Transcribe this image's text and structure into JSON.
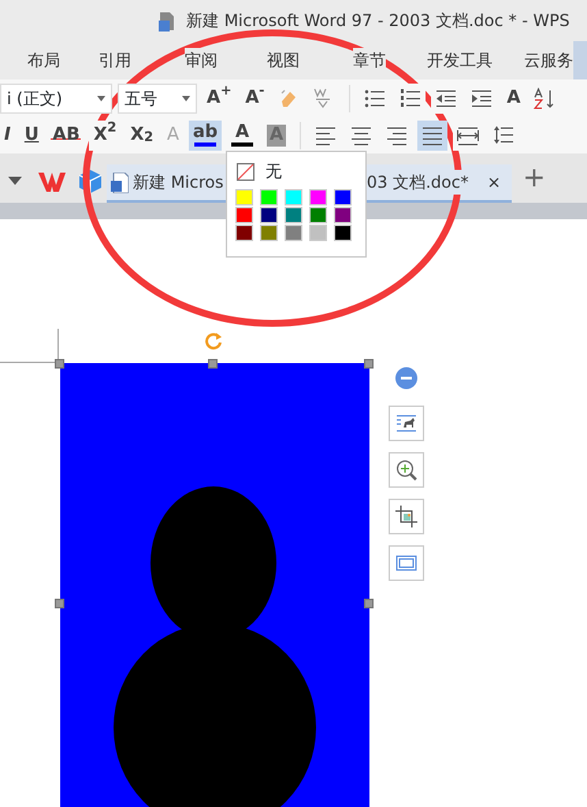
{
  "window": {
    "title": "新建 Microsoft Word 97 - 2003 文档.doc * - WPS"
  },
  "menu": [
    {
      "label": "布局"
    },
    {
      "label": "引用"
    },
    {
      "label": "审阅"
    },
    {
      "label": "视图"
    },
    {
      "label": "章节"
    },
    {
      "label": "开发工具"
    },
    {
      "label": "云服务"
    }
  ],
  "toolbar": {
    "font": "i (正文)",
    "size": "五号",
    "row1": [
      {
        "kind": "glyph",
        "text": "A$^{+}$",
        "active": false
      },
      {
        "kind": "glyph",
        "text": "A$^{-}$",
        "active": false
      },
      {
        "kind": "icon",
        "active": false
      },
      {
        "kind": "icon",
        "active": false
      },
      {
        "kind": "sep"
      },
      {
        "kind": "icon",
        "active": false
      },
      {
        "kind": "icon",
        "active": false
      },
      {
        "kind": "icon",
        "active": false
      },
      {
        "kind": "icon",
        "active": false
      },
      {
        "kind": "glyph",
        "text": "A",
        "active": false
      },
      {
        "kind": "icon",
        "active": false
      }
    ],
    "row2": [
      {
        "kind": "glyph",
        "text": "I",
        "active": false
      },
      {
        "kind": "glyph",
        "text": "U",
        "active": false
      },
      {
        "kind": "glyph",
        "text": "AB",
        "active": false
      },
      {
        "kind": "glyph",
        "text": "X$^{2}$",
        "active": false
      },
      {
        "kind": "glyph",
        "text": "X$_{2}$",
        "active": false
      },
      {
        "kind": "glyph",
        "text": "A",
        "active": false
      },
      {
        "kind": "bar",
        "text": "ab",
        "color": "#0000ff",
        "active": true
      },
      {
        "kind": "bar",
        "text": "A",
        "color": "#000000",
        "active": false
      },
      {
        "kind": "glyph",
        "text": "A",
        "active": false
      },
      {
        "kind": "sep"
      },
      {
        "kind": "icon",
        "active": false
      },
      {
        "kind": "icon",
        "active": false
      },
      {
        "kind": "icon",
        "active": false
      },
      {
        "kind": "icon",
        "active": true
      },
      {
        "kind": "icon",
        "active": false
      },
      {
        "kind": "icon",
        "active": false
      }
    ]
  },
  "tabs": [
    {
      "label_start": "新建 Micros",
      "label_end": "03 文档.doc*",
      "close": "×",
      "selected": true
    }
  ],
  "new_tab": "+",
  "color_popup": {
    "none_label": "无",
    "swatches": [
      {
        "color": "#ffff00"
      },
      {
        "color": "#00ff00"
      },
      {
        "color": "#00ffff"
      },
      {
        "color": "#ff00ff"
      },
      {
        "color": "#0000ff"
      },
      {
        "color": "#ff0000"
      },
      {
        "color": "#000080"
      },
      {
        "color": "#008080"
      },
      {
        "color": "#008000"
      },
      {
        "color": "#800080"
      },
      {
        "color": "#800000"
      },
      {
        "color": "#808000"
      },
      {
        "color": "#808080"
      },
      {
        "color": "#c0c0c0"
      },
      {
        "color": "#000000"
      }
    ]
  }
}
